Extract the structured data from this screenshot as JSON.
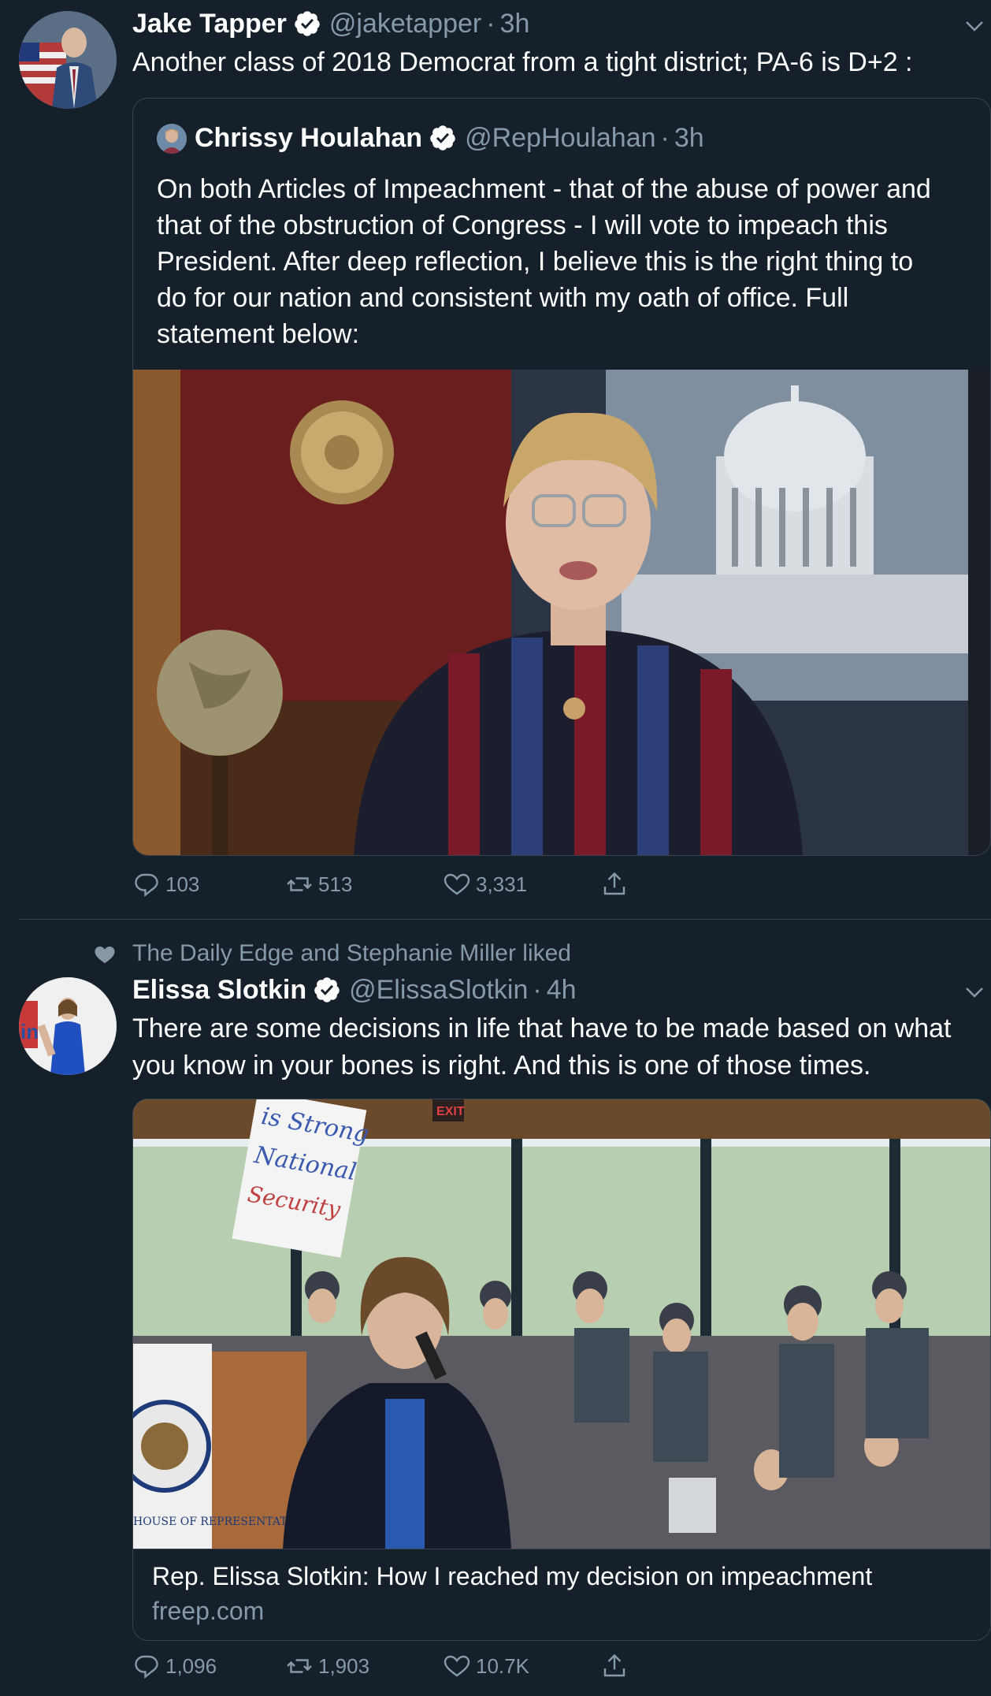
{
  "tweets": [
    {
      "author": {
        "name": "Jake Tapper",
        "handle": "@jaketapper",
        "time": "3h"
      },
      "text": "Another class of 2018 Democrat from a tight district; PA-6 is D+2 :",
      "quoted": {
        "author": {
          "name": "Chrissy Houlahan",
          "handle": "@RepHoulahan",
          "time": "3h"
        },
        "text_lines": [
          "On both Articles of Impeachment - that of the abuse of power and",
          "that of the obstruction of Congress - I will vote to impeach this",
          "President. After deep reflection, I believe this is the right thing to",
          "do for our nation and consistent with my oath of office. Full",
          "statement below:"
        ]
      },
      "stats": {
        "replies": "103",
        "retweets": "513",
        "likes": "3,331"
      }
    },
    {
      "social_context": "The Daily Edge and Stephanie Miller liked",
      "author": {
        "name": "Elissa Slotkin",
        "handle": "@ElissaSlotkin",
        "time": "4h"
      },
      "text_lines": [
        "There are some decisions in life that have to be made based on what",
        "you know in your bones is right. And this is one of those times."
      ],
      "card": {
        "title": "Rep. Elissa Slotkin: How I reached my decision on impeachment",
        "domain": "freep.com",
        "sign_text": "is Strong on National Security",
        "seal_text": "HOUSE OF REPRESENTATIVES",
        "exit_sign": "EXIT"
      },
      "stats": {
        "replies": "1,096",
        "retweets": "1,903",
        "likes": "10.7K"
      }
    }
  ],
  "colors": {
    "background": "#15202b",
    "text_secondary": "#8899a6",
    "border": "#38444d",
    "verified_blue": "#ffffff"
  }
}
